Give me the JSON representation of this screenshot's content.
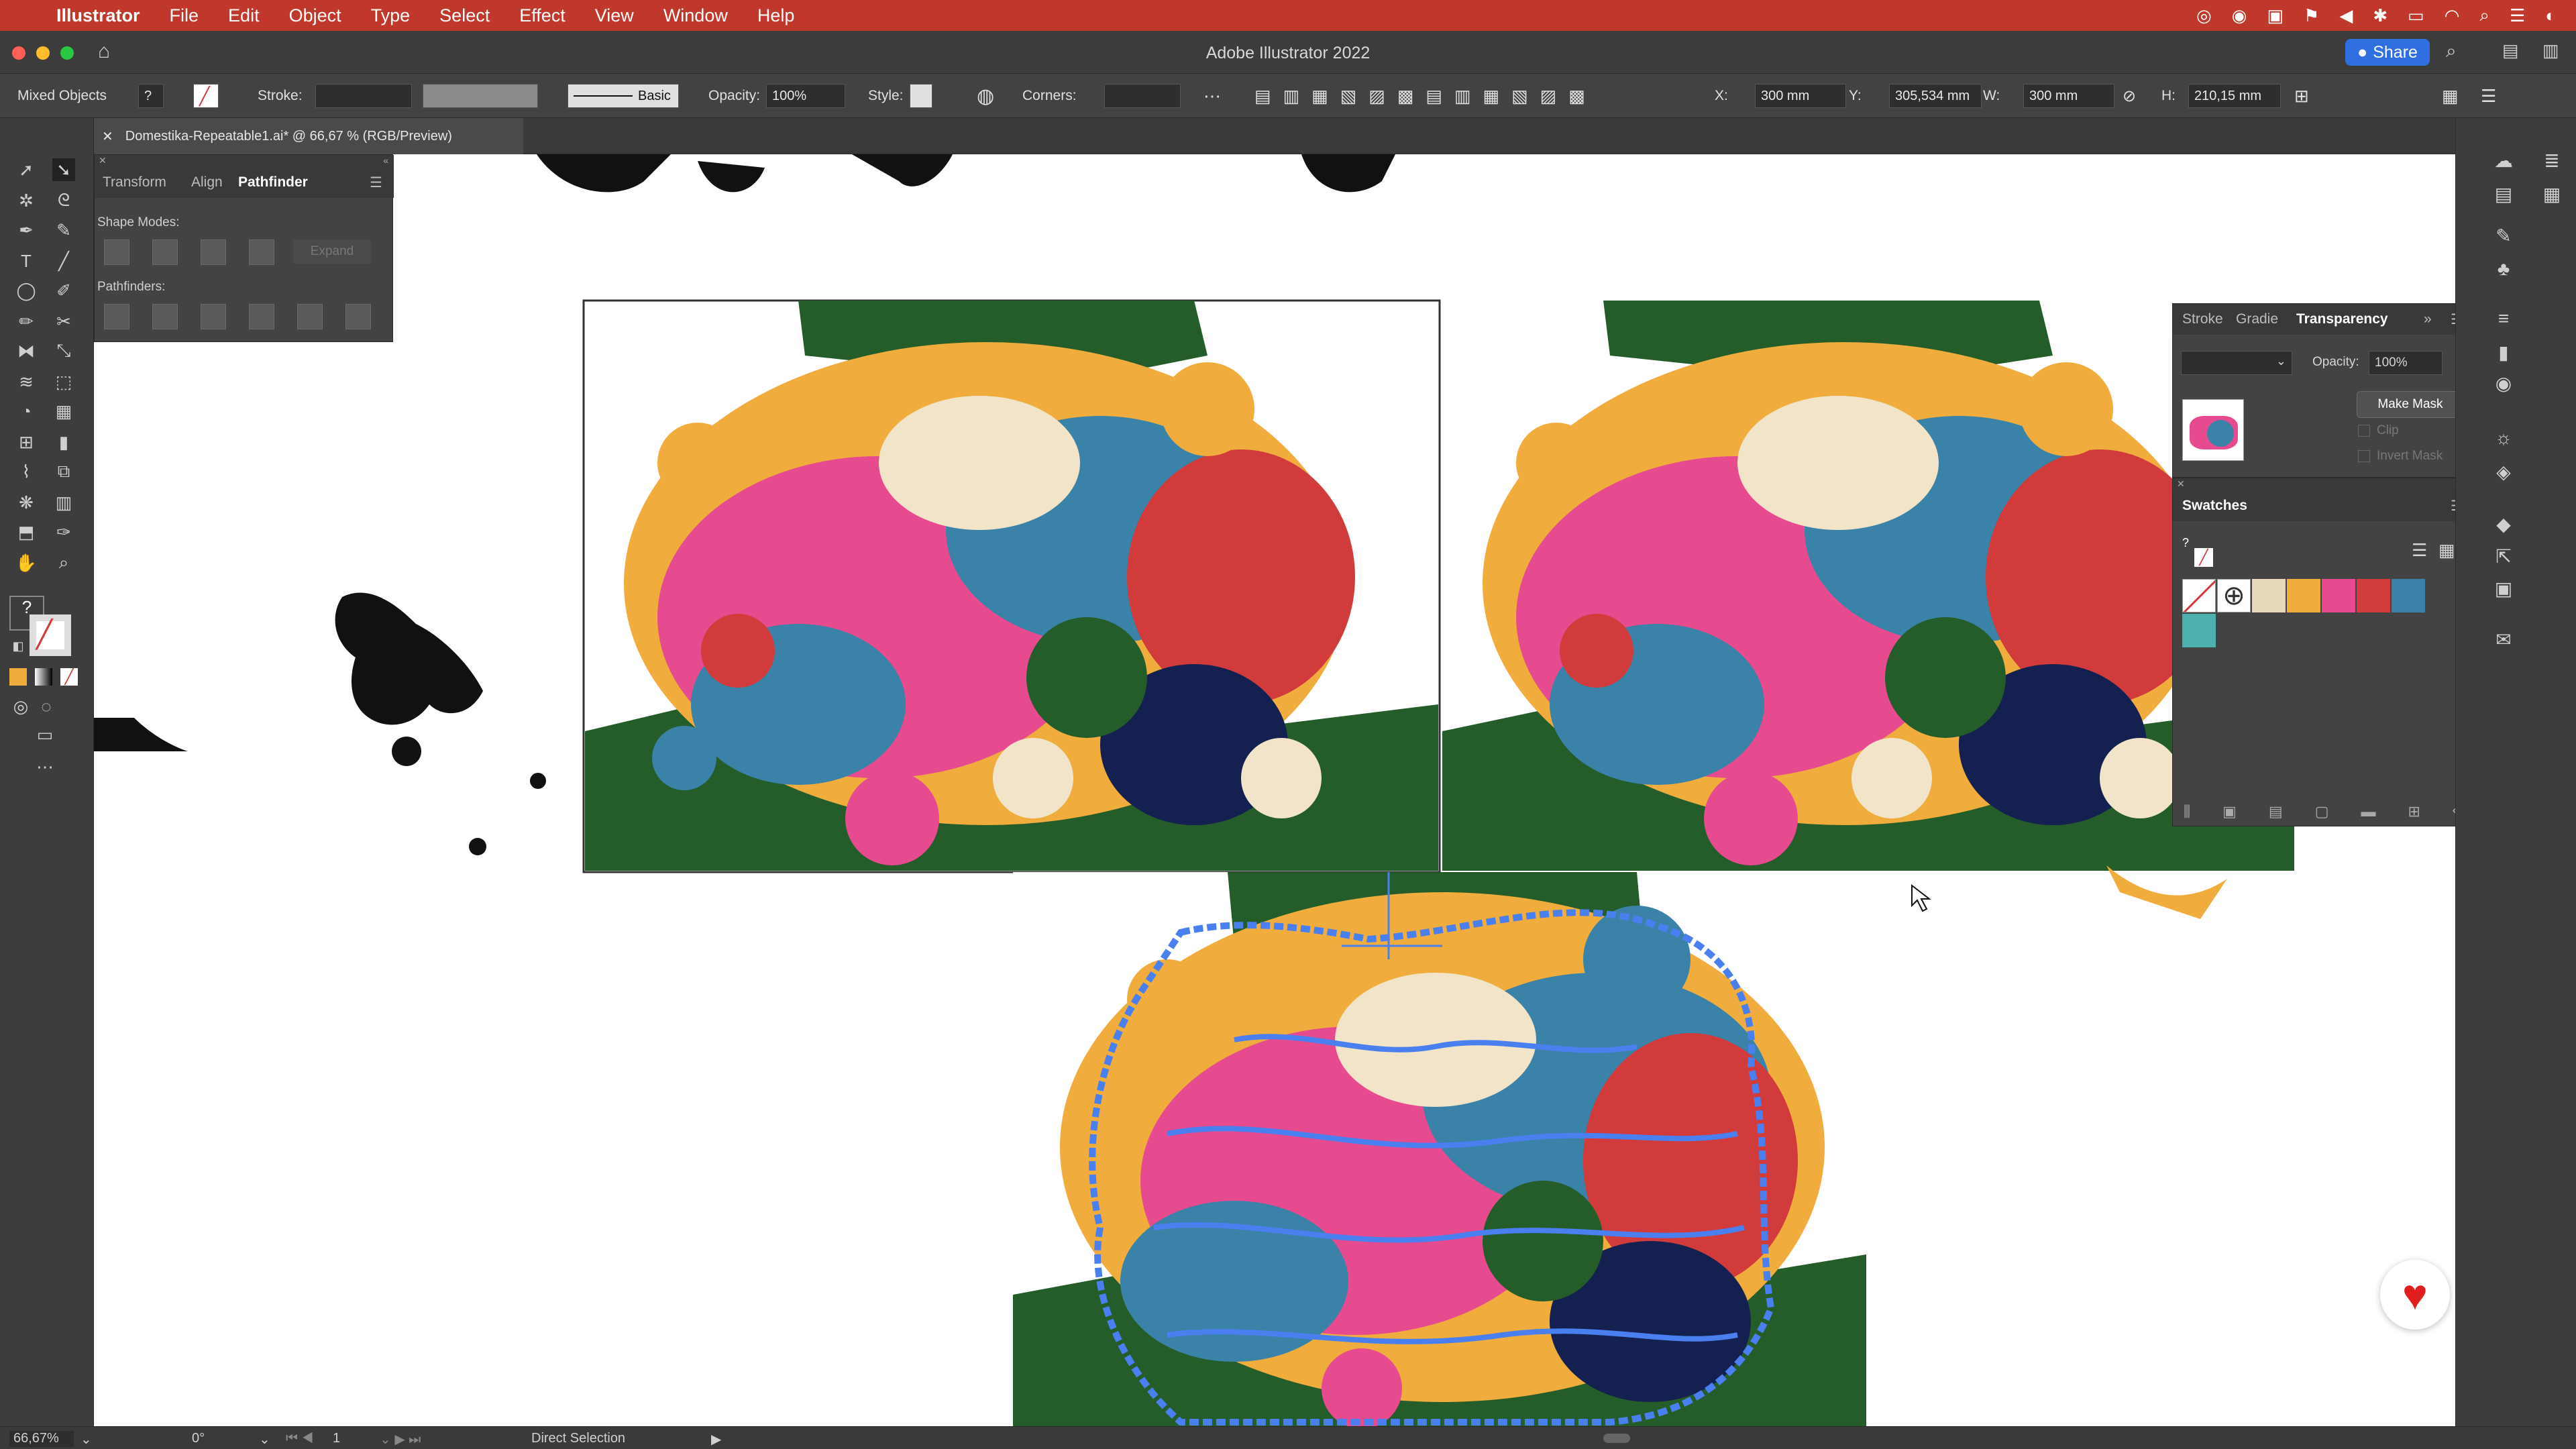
{
  "menubar": {
    "app": "Illustrator",
    "items": [
      "File",
      "Edit",
      "Object",
      "Type",
      "Select",
      "Effect",
      "View",
      "Window",
      "Help"
    ]
  },
  "titlebar": {
    "title": "Adobe Illustrator 2022",
    "share_label": "Share"
  },
  "controlbar": {
    "selection_type": "Mixed Objects",
    "stroke_label": "Stroke:",
    "brush_label": "Basic",
    "opacity_label": "Opacity:",
    "opacity_value": "100%",
    "style_label": "Style:",
    "corners_label": "Corners:",
    "x_label": "X:",
    "x_value": "300 mm",
    "y_label": "Y:",
    "y_value": "305,534 mm",
    "w_label": "W:",
    "w_value": "300 mm",
    "h_label": "H:",
    "h_value": "210,15 mm"
  },
  "document": {
    "tab_title": "Domestika-Repeatable1.ai* @ 66,67 % (RGB/Preview)"
  },
  "pathfinder_panel": {
    "tabs": [
      "Transform",
      "Align",
      "Pathfinder"
    ],
    "active_tab": "Pathfinder",
    "shape_modes_label": "Shape Modes:",
    "expand_label": "Expand",
    "pathfinders_label": "Pathfinders:"
  },
  "transparency_panel": {
    "tabs": [
      "Stroke",
      "Gradie",
      "Transparency"
    ],
    "active_tab": "Transparency",
    "opacity_label": "Opacity:",
    "opacity_value": "100%",
    "make_mask_label": "Make Mask",
    "clip_label": "Clip",
    "invert_mask_label": "Invert Mask"
  },
  "swatches_panel": {
    "title": "Swatches",
    "swatches": [
      "#e8d9b8",
      "#f0ad3e",
      "#e64b8f",
      "#d13b3b",
      "#3a82a8",
      "#4fb0b0"
    ]
  },
  "statusbar": {
    "zoom": "66,67%",
    "rotation": "0°",
    "artboard": "1",
    "tool": "Direct Selection"
  },
  "colors": {
    "menubar": "#c0382b",
    "accent": "#2f6fe0",
    "dark_green": "#245c2a",
    "orange": "#f0ad3e",
    "pink": "#e64b8f",
    "red": "#d13b3b",
    "blue": "#3a82a8",
    "navy": "#14204f",
    "cream": "#f1e4c9",
    "selection_blue": "#4a7ff0"
  }
}
